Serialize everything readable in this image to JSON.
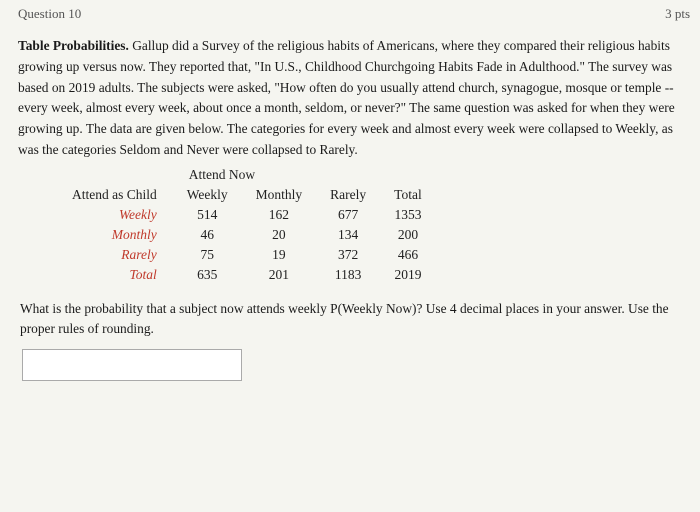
{
  "header": {
    "question_label": "Question 10",
    "score": "3 pts"
  },
  "description": {
    "bold_intro": "Table Probabilities.",
    "text": " Gallup did a Survey of the religious habits of Americans, where they compared their religious habits growing up versus now. They reported that, \"In U.S., Childhood Churchgoing Habits Fade in Adulthood.\" The survey was based on 2019 adults. The subjects were asked, \"How often do you usually attend church, synagogue, mosque or temple -- every week, almost every week, about once a month, seldom, or never?\" The same question was asked for when they were growing up. The data are given below. The categories for every week and almost every week were collapsed to Weekly, as was the categories Seldom and Never were collapsed to Rarely."
  },
  "table": {
    "attend_now_label": "Attend Now",
    "row_header_label": "Attend as Child",
    "col_headers": [
      "Weekly",
      "Monthly",
      "Rarely",
      "Total"
    ],
    "rows": [
      {
        "label": "Weekly",
        "values": [
          "514",
          "162",
          "677",
          "1353"
        ]
      },
      {
        "label": "Monthly",
        "values": [
          "46",
          "20",
          "134",
          "200"
        ]
      },
      {
        "label": "Rarely",
        "values": [
          "75",
          "19",
          "372",
          "466"
        ]
      },
      {
        "label": "Total",
        "values": [
          "635",
          "201",
          "1183",
          "2019"
        ],
        "is_total": true
      }
    ]
  },
  "footer": {
    "question_text": "What is the probability that a subject now attends weekly P(Weekly Now)?  Use 4 decimal places in your answer.  Use the proper rules of rounding."
  }
}
